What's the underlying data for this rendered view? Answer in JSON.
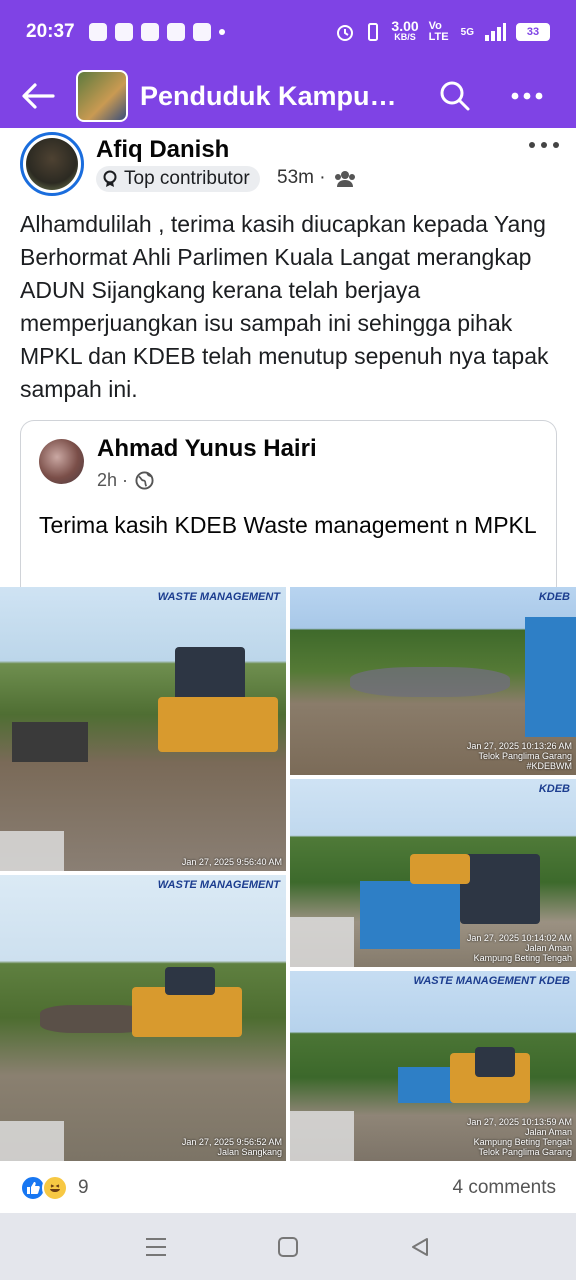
{
  "status_bar": {
    "time": "20:37",
    "speed_value": "3.00",
    "speed_unit": "KB/S",
    "volte": "Vo LTE",
    "network": "5G",
    "battery": "33"
  },
  "app_bar": {
    "group_name": "Penduduk Kampung...",
    "back_icon": "back-arrow-icon",
    "search_icon": "search-icon",
    "more_icon": "more-options-icon",
    "accent_color": "#7f43e5"
  },
  "post": {
    "author": "Afiq Danish",
    "badge": "Top contributor",
    "time": "53m ·",
    "audience_icon": "group-icon",
    "text": "Alhamdulilah , terima kasih diucapkan kepada Yang Berhormat Ahli Parlimen Kuala Langat merangkap ADUN Sijangkang kerana telah berjaya memperjuangkan isu sampah ini sehingga pihak MPKL dan KDEB telah menutup sepenuh nya tapak sampah ini."
  },
  "shared_post": {
    "author": "Ahmad Yunus Hairi",
    "time": "2h ·",
    "audience_icon": "globe-icon",
    "text": "Terima kasih KDEB Waste management n MPKL"
  },
  "photos": [
    {
      "stamp": "Jan 27, 2025 9:56:40 AM",
      "logo": "WASTE MANAGEMENT"
    },
    {
      "stamp": "Jan 27, 2025 10:13:26 AM\nTelok Panglima Garang\n#KDEBWM",
      "logo": "KDEB"
    },
    {
      "stamp": "Jan 27, 2025 9:56:52 AM\nJalan Sangkang",
      "logo": "WASTE MANAGEMENT"
    },
    {
      "stamp": "Jan 27, 2025 10:14:02 AM\nJalan Aman\nKampung Beting Tengah",
      "logo": "KDEB"
    },
    {
      "stamp": "Jan 27, 2025 10:13:59 AM\nJalan Aman\nKampung Beting Tengah\nTelok Panglima Garang",
      "logo": "WASTE MANAGEMENT KDEB"
    }
  ],
  "reactions": {
    "count": "9",
    "comments": "4 comments"
  },
  "nav": {
    "recent_icon": "recent-apps-icon",
    "home_icon": "home-icon",
    "back_icon": "nav-back-icon"
  }
}
